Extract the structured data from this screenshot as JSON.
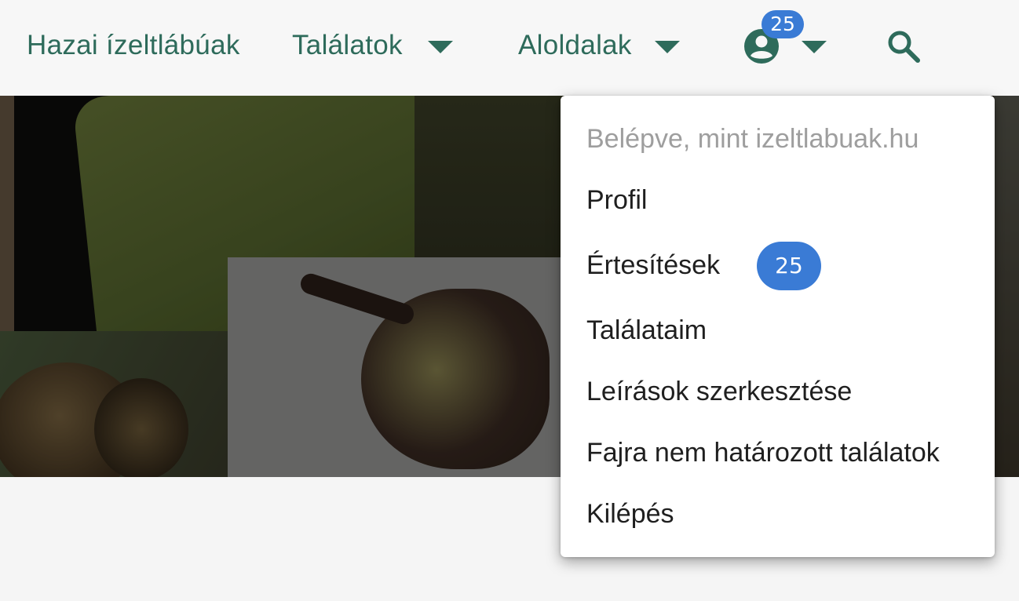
{
  "navbar": {
    "brand": "Hazai ízeltlábúak",
    "findings": "Találatok",
    "subpages": "Aloldalak",
    "notification_count": "25",
    "icons": {
      "user": "account-circle-icon",
      "search": "search-icon",
      "dropdown": "caret-down-icon"
    }
  },
  "user_menu": {
    "header": "Belépve, mint izeltlabuak.hu",
    "items": [
      {
        "label": "Profil"
      },
      {
        "label": "Értesítések",
        "badge": "25"
      },
      {
        "label": "Találataim"
      },
      {
        "label": "Leírások szerkesztése"
      },
      {
        "label": "Fajra nem határozott találatok"
      },
      {
        "label": "Kilépés"
      }
    ]
  },
  "colors": {
    "nav_text": "#2e6b5b",
    "badge": "#3a7bd5",
    "background": "#f5f5f5"
  }
}
